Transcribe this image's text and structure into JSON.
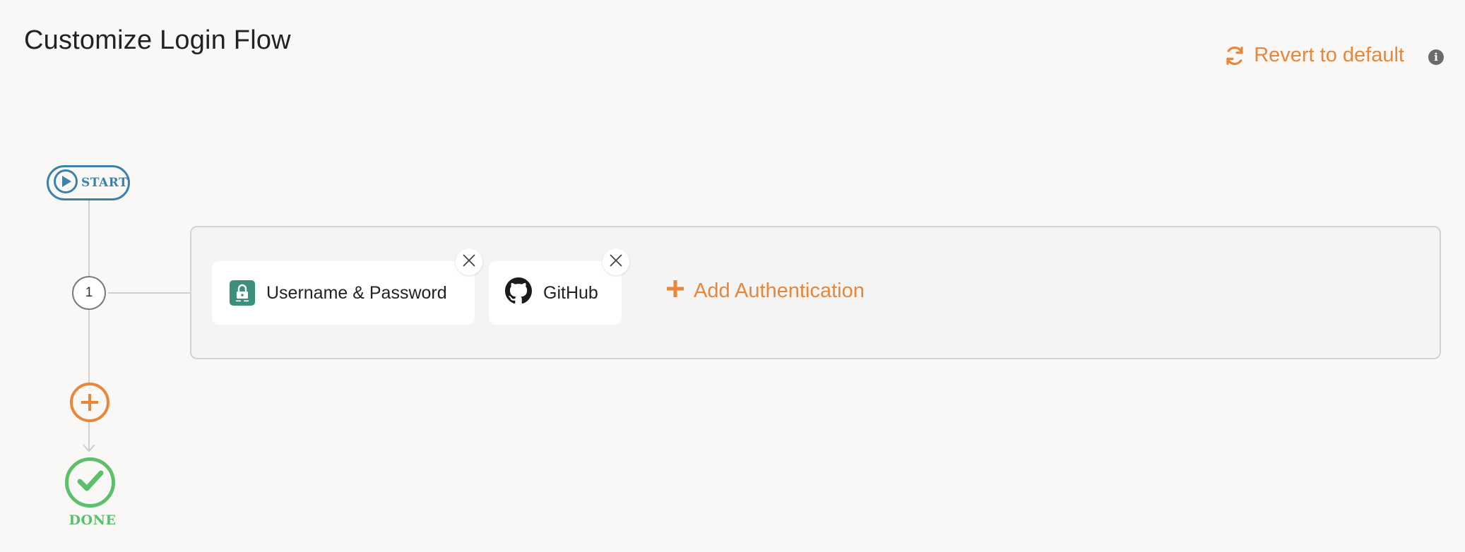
{
  "header": {
    "title": "Customize Login Flow",
    "revert_label": "Revert to default",
    "revert_icon": "refresh-icon",
    "info_icon": "info-icon",
    "info_glyph": "i"
  },
  "flow": {
    "start_label": "START",
    "step_number": "1",
    "done_label": "DONE"
  },
  "step": {
    "methods": [
      {
        "label": "Username & Password",
        "icon": "lock-icon"
      },
      {
        "label": "GitHub",
        "icon": "github-icon"
      }
    ],
    "add_label": "Add Authentication"
  },
  "colors": {
    "accent": "#e8863a",
    "start": "#3b82aa",
    "done": "#5cc06b",
    "lock_badge": "#3d8f7d"
  }
}
